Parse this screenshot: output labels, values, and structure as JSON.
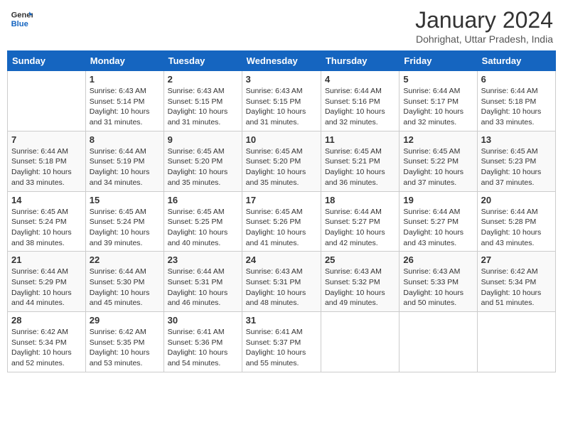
{
  "header": {
    "logo_line1": "General",
    "logo_line2": "Blue",
    "month": "January 2024",
    "location": "Dohrighat, Uttar Pradesh, India"
  },
  "days_of_week": [
    "Sunday",
    "Monday",
    "Tuesday",
    "Wednesday",
    "Thursday",
    "Friday",
    "Saturday"
  ],
  "weeks": [
    [
      {
        "day": "",
        "info": ""
      },
      {
        "day": "1",
        "info": "Sunrise: 6:43 AM\nSunset: 5:14 PM\nDaylight: 10 hours and 31 minutes."
      },
      {
        "day": "2",
        "info": "Sunrise: 6:43 AM\nSunset: 5:15 PM\nDaylight: 10 hours and 31 minutes."
      },
      {
        "day": "3",
        "info": "Sunrise: 6:43 AM\nSunset: 5:15 PM\nDaylight: 10 hours and 31 minutes."
      },
      {
        "day": "4",
        "info": "Sunrise: 6:44 AM\nSunset: 5:16 PM\nDaylight: 10 hours and 32 minutes."
      },
      {
        "day": "5",
        "info": "Sunrise: 6:44 AM\nSunset: 5:17 PM\nDaylight: 10 hours and 32 minutes."
      },
      {
        "day": "6",
        "info": "Sunrise: 6:44 AM\nSunset: 5:18 PM\nDaylight: 10 hours and 33 minutes."
      }
    ],
    [
      {
        "day": "7",
        "info": "Sunrise: 6:44 AM\nSunset: 5:18 PM\nDaylight: 10 hours and 33 minutes."
      },
      {
        "day": "8",
        "info": "Sunrise: 6:44 AM\nSunset: 5:19 PM\nDaylight: 10 hours and 34 minutes."
      },
      {
        "day": "9",
        "info": "Sunrise: 6:45 AM\nSunset: 5:20 PM\nDaylight: 10 hours and 35 minutes."
      },
      {
        "day": "10",
        "info": "Sunrise: 6:45 AM\nSunset: 5:20 PM\nDaylight: 10 hours and 35 minutes."
      },
      {
        "day": "11",
        "info": "Sunrise: 6:45 AM\nSunset: 5:21 PM\nDaylight: 10 hours and 36 minutes."
      },
      {
        "day": "12",
        "info": "Sunrise: 6:45 AM\nSunset: 5:22 PM\nDaylight: 10 hours and 37 minutes."
      },
      {
        "day": "13",
        "info": "Sunrise: 6:45 AM\nSunset: 5:23 PM\nDaylight: 10 hours and 37 minutes."
      }
    ],
    [
      {
        "day": "14",
        "info": "Sunrise: 6:45 AM\nSunset: 5:24 PM\nDaylight: 10 hours and 38 minutes."
      },
      {
        "day": "15",
        "info": "Sunrise: 6:45 AM\nSunset: 5:24 PM\nDaylight: 10 hours and 39 minutes."
      },
      {
        "day": "16",
        "info": "Sunrise: 6:45 AM\nSunset: 5:25 PM\nDaylight: 10 hours and 40 minutes."
      },
      {
        "day": "17",
        "info": "Sunrise: 6:45 AM\nSunset: 5:26 PM\nDaylight: 10 hours and 41 minutes."
      },
      {
        "day": "18",
        "info": "Sunrise: 6:44 AM\nSunset: 5:27 PM\nDaylight: 10 hours and 42 minutes."
      },
      {
        "day": "19",
        "info": "Sunrise: 6:44 AM\nSunset: 5:27 PM\nDaylight: 10 hours and 43 minutes."
      },
      {
        "day": "20",
        "info": "Sunrise: 6:44 AM\nSunset: 5:28 PM\nDaylight: 10 hours and 43 minutes."
      }
    ],
    [
      {
        "day": "21",
        "info": "Sunrise: 6:44 AM\nSunset: 5:29 PM\nDaylight: 10 hours and 44 minutes."
      },
      {
        "day": "22",
        "info": "Sunrise: 6:44 AM\nSunset: 5:30 PM\nDaylight: 10 hours and 45 minutes."
      },
      {
        "day": "23",
        "info": "Sunrise: 6:44 AM\nSunset: 5:31 PM\nDaylight: 10 hours and 46 minutes."
      },
      {
        "day": "24",
        "info": "Sunrise: 6:43 AM\nSunset: 5:31 PM\nDaylight: 10 hours and 48 minutes."
      },
      {
        "day": "25",
        "info": "Sunrise: 6:43 AM\nSunset: 5:32 PM\nDaylight: 10 hours and 49 minutes."
      },
      {
        "day": "26",
        "info": "Sunrise: 6:43 AM\nSunset: 5:33 PM\nDaylight: 10 hours and 50 minutes."
      },
      {
        "day": "27",
        "info": "Sunrise: 6:42 AM\nSunset: 5:34 PM\nDaylight: 10 hours and 51 minutes."
      }
    ],
    [
      {
        "day": "28",
        "info": "Sunrise: 6:42 AM\nSunset: 5:34 PM\nDaylight: 10 hours and 52 minutes."
      },
      {
        "day": "29",
        "info": "Sunrise: 6:42 AM\nSunset: 5:35 PM\nDaylight: 10 hours and 53 minutes."
      },
      {
        "day": "30",
        "info": "Sunrise: 6:41 AM\nSunset: 5:36 PM\nDaylight: 10 hours and 54 minutes."
      },
      {
        "day": "31",
        "info": "Sunrise: 6:41 AM\nSunset: 5:37 PM\nDaylight: 10 hours and 55 minutes."
      },
      {
        "day": "",
        "info": ""
      },
      {
        "day": "",
        "info": ""
      },
      {
        "day": "",
        "info": ""
      }
    ]
  ]
}
